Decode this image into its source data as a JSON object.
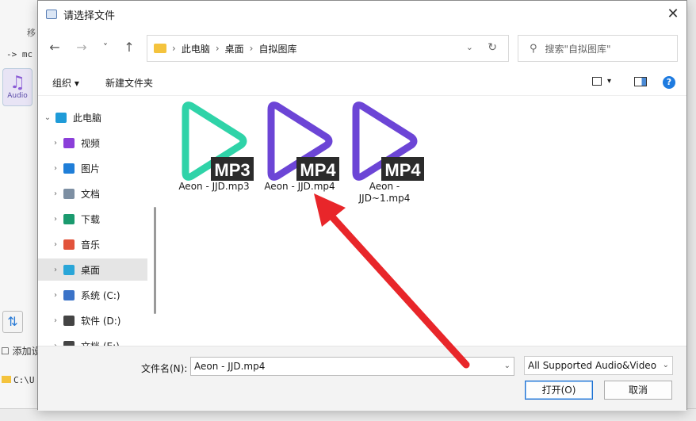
{
  "dialog": {
    "title": "请选择文件",
    "nav": {
      "back": "←",
      "forward": "→",
      "recent": "˅",
      "up": "↑"
    },
    "address": {
      "crumbs": [
        "此电脑",
        "桌面",
        "自拟图库"
      ]
    },
    "search_placeholder": "搜索\"自拟图库\"",
    "commands": {
      "organize": "组织 ▾",
      "new_folder": "新建文件夹"
    },
    "sidebar": [
      {
        "label": "此电脑",
        "icon": "monitor-icon",
        "color": "#1f9bd8"
      },
      {
        "label": "视频",
        "icon": "video-icon",
        "color": "#8b3fd9"
      },
      {
        "label": "图片",
        "icon": "image-icon",
        "color": "#1f7ed8"
      },
      {
        "label": "文档",
        "icon": "document-icon",
        "color": "#7d8fa3"
      },
      {
        "label": "下载",
        "icon": "download-icon",
        "color": "#1a9a6e"
      },
      {
        "label": "音乐",
        "icon": "music-icon",
        "color": "#e2533b"
      },
      {
        "label": "桌面",
        "icon": "desktop-icon",
        "color": "#2aa6d8"
      },
      {
        "label": "系统 (C:)",
        "icon": "drive-icon",
        "color": "#3b73c8"
      },
      {
        "label": "软件 (D:)",
        "icon": "drive-icon",
        "color": "#444444"
      },
      {
        "label": "文档 (E:)",
        "icon": "drive-icon",
        "color": "#444444"
      }
    ],
    "files": [
      {
        "name": "Aeon - JJD.mp3",
        "badge": "MP3",
        "color": "#2fd3a8"
      },
      {
        "name": "Aeon - JJD.mp4",
        "badge": "MP4",
        "color": "#6c45d6"
      },
      {
        "name": "Aeon - JJD~1.mp4",
        "badge": "MP4",
        "color": "#6c45d6"
      }
    ],
    "filename_label": "文件名(N):",
    "filename_value": "Aeon - JJD.mp4",
    "filetype_value": "All Supported Audio&Video",
    "open_label": "打开(O)",
    "cancel_label": "取消"
  },
  "background": {
    "audio_label": "Audio",
    "add_label": "添加设",
    "path_text": "C:\\U",
    "arrow_text": "-> mc",
    "move_text": "移"
  },
  "colors": {
    "accent": "#1e7be0",
    "arrow": "#e8262a"
  }
}
